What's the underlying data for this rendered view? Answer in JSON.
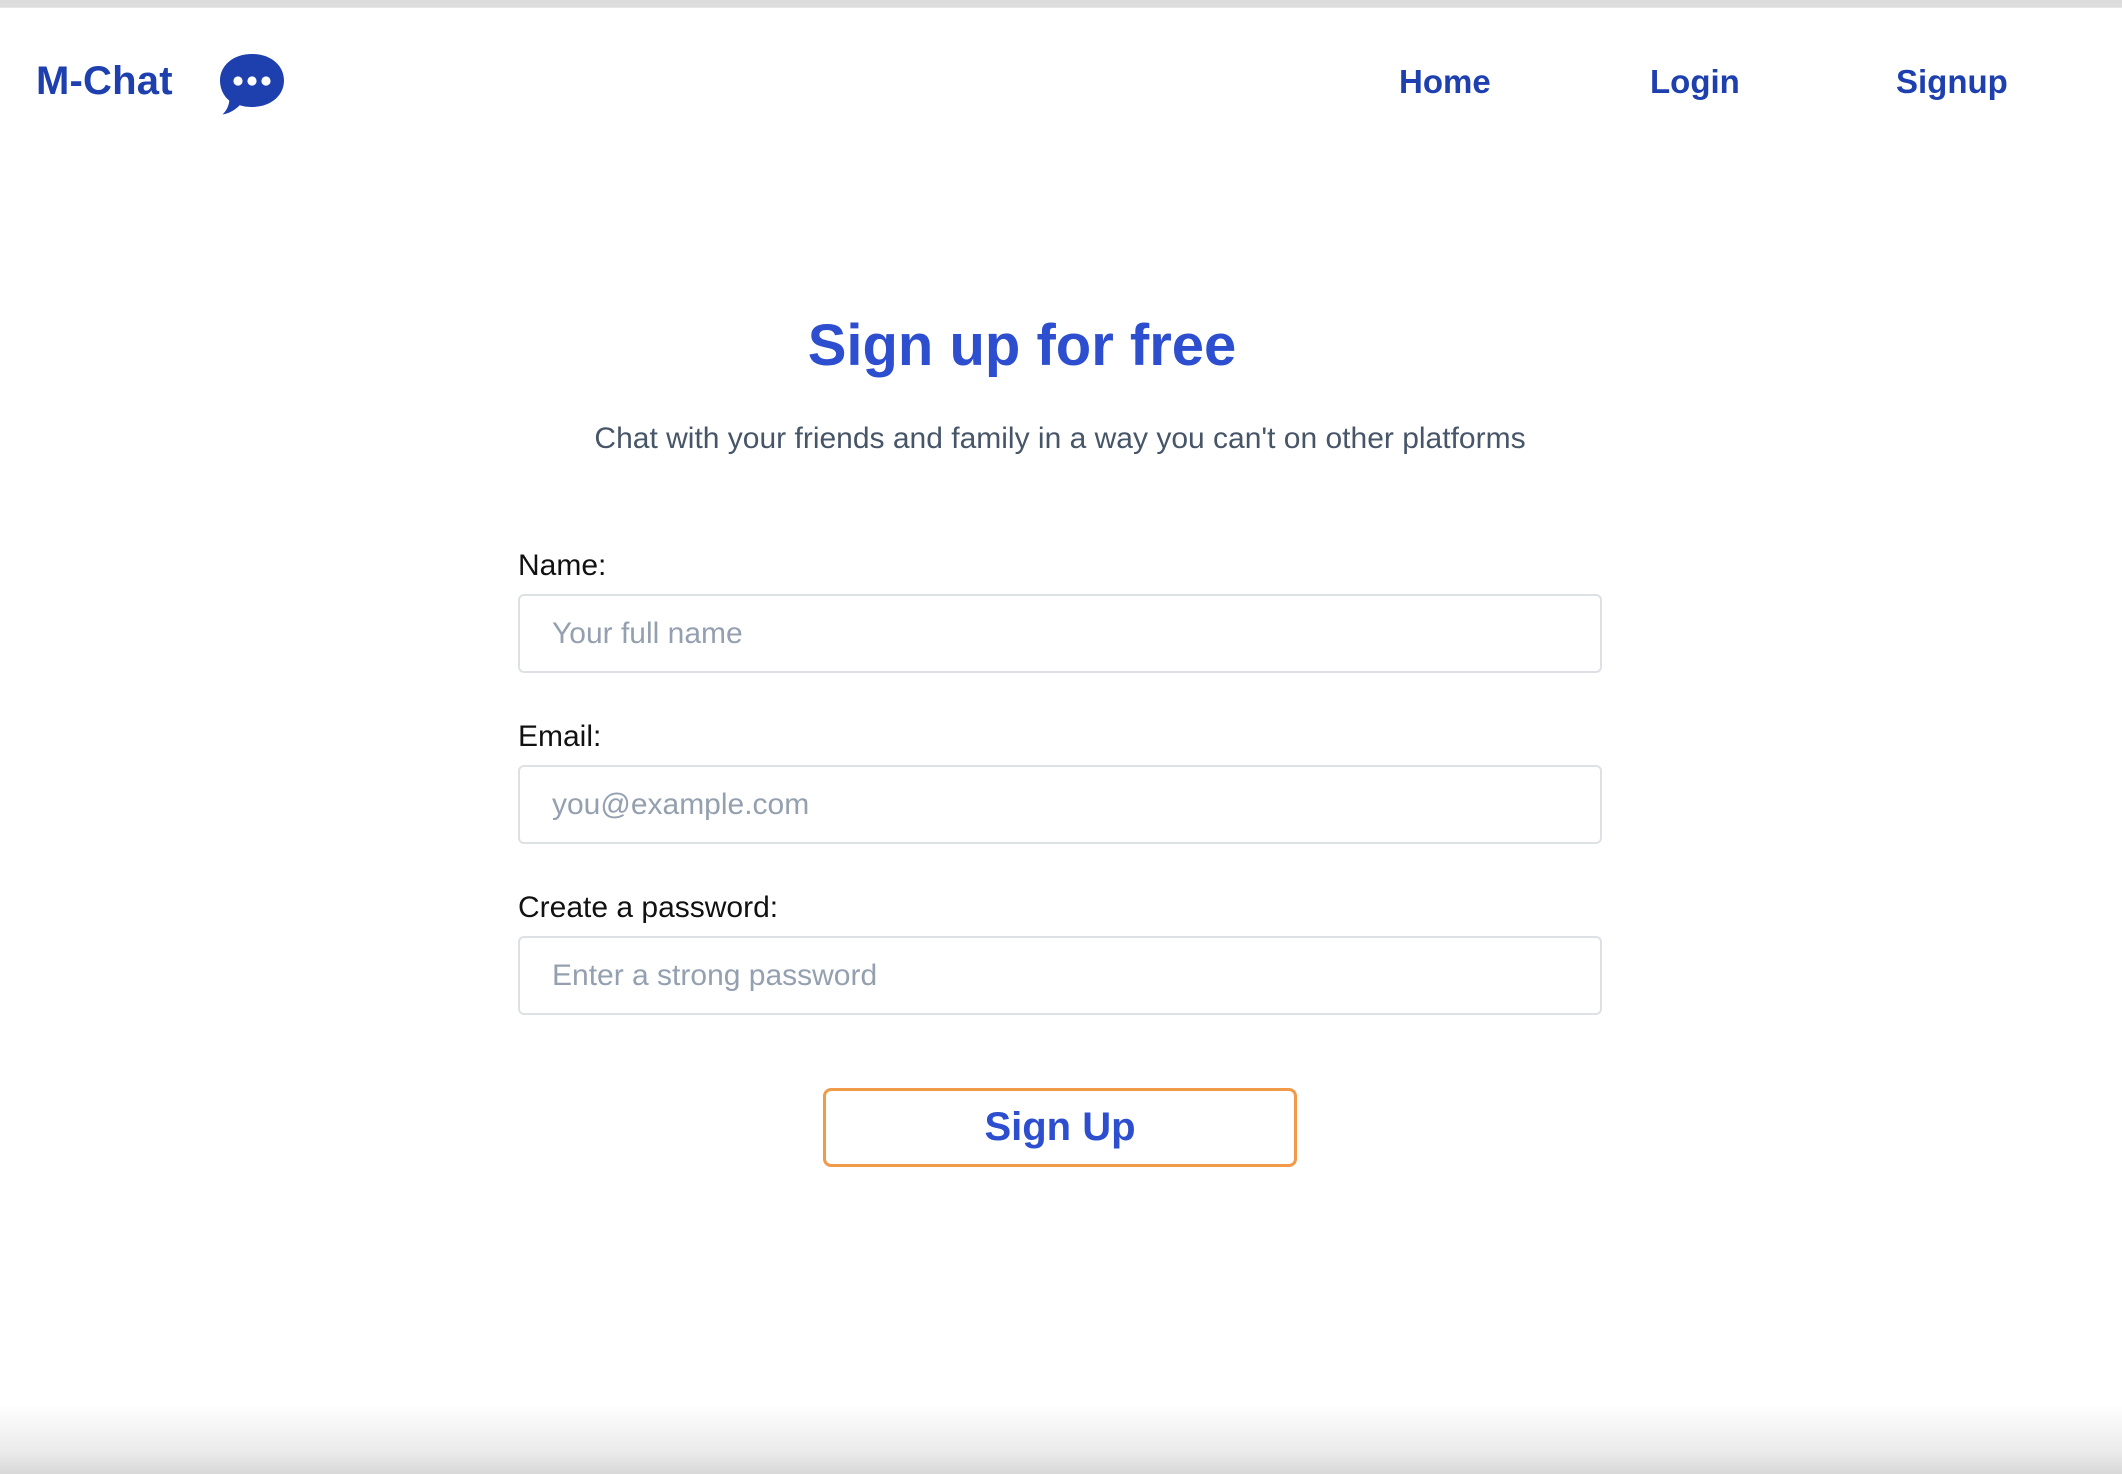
{
  "navbar": {
    "brand": "M-Chat",
    "brand_icon": "chat-bubble-icon",
    "links": [
      {
        "label": "Home"
      },
      {
        "label": "Login"
      },
      {
        "label": "Signup"
      }
    ]
  },
  "hero": {
    "title": "Sign up for free",
    "subtitle": "Chat with your friends and family in a way you can't on other platforms"
  },
  "form": {
    "name_label": "Name:",
    "name_placeholder": "Your full name",
    "email_label": "Email:",
    "email_placeholder": "you@example.com",
    "password_label": "Create a password:",
    "password_placeholder": "Enter a strong password",
    "submit_label": "Sign Up"
  },
  "colors": {
    "brand": "#1e40af",
    "title": "#2c4ecf",
    "button_border": "#f09a4a",
    "subtitle": "#475569"
  }
}
